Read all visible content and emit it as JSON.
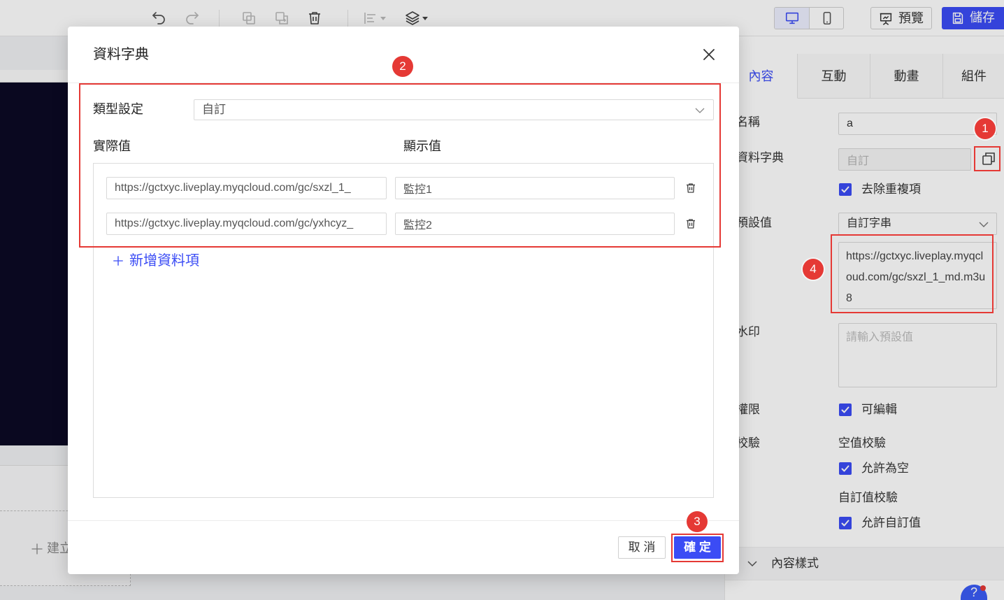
{
  "toolbar": {
    "icons": [
      "undo-icon",
      "redo-icon",
      "copy-icon",
      "duplicate-icon",
      "trash-icon",
      "align-icon",
      "layers-icon",
      "desktop-icon",
      "mobile-icon",
      "preview-icon",
      "save-icon"
    ],
    "preview_label": "預覽",
    "save_label": "儲存"
  },
  "canvas": {
    "create_label": "建立"
  },
  "panel": {
    "tabs": [
      {
        "label": "內容",
        "active": true
      },
      {
        "label": "互動",
        "active": false
      },
      {
        "label": "動畫",
        "active": false
      },
      {
        "label": "組件",
        "active": false
      }
    ],
    "name": {
      "label": "名稱",
      "value": "a"
    },
    "dictionary": {
      "label": "資料字典",
      "value": "自訂"
    },
    "dedupe": {
      "label": "去除重複項",
      "checked": true
    },
    "default_value": {
      "label": "預設值",
      "select": "自訂字串",
      "text": "https://gctxyc.liveplay.myqcloud.com/gc/sxzl_1_md.m3u8"
    },
    "watermark": {
      "label": "水印",
      "placeholder": "請輸入預設值"
    },
    "permission": {
      "label": "權限",
      "option": "可編輯",
      "checked": true
    },
    "validation": {
      "label": "校驗",
      "empty_title": "空值校驗",
      "allow_empty": "允許為空",
      "custom_title": "自訂值校驗",
      "allow_custom": "允許自訂值"
    },
    "content_style": {
      "label": "內容樣式"
    }
  },
  "help": {
    "label": "?"
  },
  "annotations": [
    "1",
    "2",
    "3",
    "4"
  ],
  "modal": {
    "title": "資料字典",
    "type_label": "類型設定",
    "type_value": "自訂",
    "col_actual": "實際值",
    "col_display": "顯示值",
    "rows": [
      {
        "actual": "https://gctxyc.liveplay.myqcloud.com/gc/sxzl_1_",
        "display": "監控1"
      },
      {
        "actual": "https://gctxyc.liveplay.myqcloud.com/gc/yxhcyz_",
        "display": "監控2"
      }
    ],
    "add_label": "新增資料項",
    "cancel_label": "取 消",
    "confirm_label": "確 定"
  },
  "colors": {
    "accent": "#3b4cf5",
    "annotation": "#e53935",
    "canvas": "#0c0a24"
  }
}
